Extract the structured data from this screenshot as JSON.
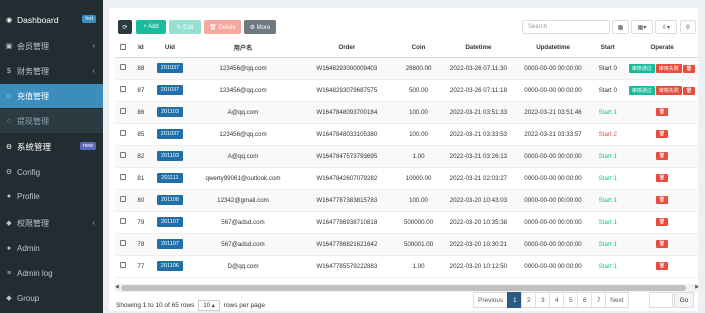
{
  "sidebar": {
    "items": [
      {
        "label": "Dashboard",
        "icon": "dashboard-icon",
        "glyph": "◉",
        "badge": "hot"
      },
      {
        "label": "会员管理",
        "icon": "user-group-icon",
        "glyph": "▣"
      },
      {
        "label": "财务管理",
        "icon": "finance-icon",
        "glyph": "$"
      },
      {
        "label": "充值管理",
        "icon": "circle-icon",
        "glyph": "○"
      },
      {
        "label": "提现管理",
        "icon": "circle-icon",
        "glyph": "○"
      },
      {
        "label": "系统管理",
        "icon": "cogs-icon",
        "glyph": "⚙",
        "badge": "new"
      },
      {
        "label": "Config",
        "icon": "gear-icon",
        "glyph": "⚙"
      },
      {
        "label": "Profile",
        "icon": "user-icon",
        "glyph": "●"
      },
      {
        "label": "权限管理",
        "icon": "group-icon",
        "glyph": "◆"
      },
      {
        "label": "Admin",
        "icon": "user-icon",
        "glyph": "●"
      },
      {
        "label": "Admin log",
        "icon": "list-icon",
        "glyph": "≡"
      },
      {
        "label": "Group",
        "icon": "group-icon",
        "glyph": "◆"
      }
    ]
  },
  "toolbar": {
    "refresh": "⟳",
    "add": "+ Add",
    "edit": "✎ Edit",
    "delete": "🗑 Delete",
    "more": "⚙ More",
    "search_placeholder": "Search",
    "table_icon": "▦",
    "columns_icon": "▦▾",
    "export_icon": "⇩▾",
    "search_icon": "⚲"
  },
  "table": {
    "headers": [
      "",
      "Id",
      "Uid",
      "用户名",
      "Order",
      "Coin",
      "Datetime",
      "Updatetime",
      "Start",
      "Operate"
    ],
    "rows": [
      {
        "id": "88",
        "uid": "201037",
        "user": "123456@qq.com",
        "order": "W1648293000009403",
        "coin": "28800.00",
        "datetime": "2022-03-26 07:11:30",
        "updatetime": "0000-00-00 00:00:00",
        "start": "Start 0",
        "start_class": "start-0",
        "ops": [
          "审核通过",
          "审核失败"
        ]
      },
      {
        "id": "87",
        "uid": "201037",
        "user": "123456@qq.com",
        "order": "W1648293079687575",
        "coin": "500.00",
        "datetime": "2022-03-26 07:11:18",
        "updatetime": "0000-00-00 00:00:00",
        "start": "Start 0",
        "start_class": "start-0",
        "ops": [
          "审核通过",
          "审核失败"
        ]
      },
      {
        "id": "86",
        "uid": "201103",
        "user": "A@qq.com",
        "order": "W1647848093700184",
        "coin": "100.00",
        "datetime": "2022-03-21 03:51:33",
        "updatetime": "2022-03-21 03:51:46",
        "start": "Start 1",
        "start_class": "start-1",
        "ops": []
      },
      {
        "id": "85",
        "uid": "201037",
        "user": "123456@qq.com",
        "order": "W1647848033105380",
        "coin": "100.00",
        "datetime": "2022-03-21 03:33:53",
        "updatetime": "2022-03-21 03:33:57",
        "start": "Start 2",
        "start_class": "start-2",
        "ops": []
      },
      {
        "id": "82",
        "uid": "201103",
        "user": "A@qq.com",
        "order": "W1647847573793695",
        "coin": "1.00",
        "datetime": "2022-03-21 03:26:13",
        "updatetime": "0000-00-00 00:00:00",
        "start": "Start 1",
        "start_class": "start-1",
        "ops": []
      },
      {
        "id": "81",
        "uid": "201111",
        "user": "qwerty99061@outlook.com",
        "order": "W1647842607079282",
        "coin": "10000.00",
        "datetime": "2022-03-21 02:03:27",
        "updatetime": "0000-00-00 00:00:00",
        "start": "Start 1",
        "start_class": "start-1",
        "ops": []
      },
      {
        "id": "80",
        "uid": "201108",
        "user": "12342@gmail.com",
        "order": "W1647787383815783",
        "coin": "100.00",
        "datetime": "2022-03-20 10:43:03",
        "updatetime": "0000-00-00 00:00:00",
        "start": "Start 1",
        "start_class": "start-1",
        "ops": []
      },
      {
        "id": "79",
        "uid": "201107",
        "user": "567@adsd.com",
        "order": "W1647786938710818",
        "coin": "500000.00",
        "datetime": "2022-03-20 10:35:38",
        "updatetime": "0000-00-00 00:00:00",
        "start": "Start 1",
        "start_class": "start-1",
        "ops": []
      },
      {
        "id": "78",
        "uid": "201107",
        "user": "567@adsd.com",
        "order": "W1647786821621642",
        "coin": "500001.00",
        "datetime": "2022-03-20 10:30:21",
        "updatetime": "0000-00-00 00:00:00",
        "start": "Start 1",
        "start_class": "start-1",
        "ops": []
      },
      {
        "id": "77",
        "uid": "201106",
        "user": "D@qq.com",
        "order": "W1647785579222883",
        "coin": "1.00",
        "datetime": "2022-03-20 10:12:50",
        "updatetime": "0000-00-00 00:00:00",
        "start": "Start 1",
        "start_class": "start-1",
        "ops": []
      }
    ]
  },
  "footer": {
    "showing_prefix": "Showing 1 to 10 of 65 rows",
    "page_size": "10 ▴",
    "showing_suffix": "rows per page",
    "pages": [
      "Previous",
      "1",
      "2",
      "3",
      "4",
      "5",
      "6",
      "7",
      "Next"
    ],
    "active_page": "1",
    "go_label": "Go"
  }
}
